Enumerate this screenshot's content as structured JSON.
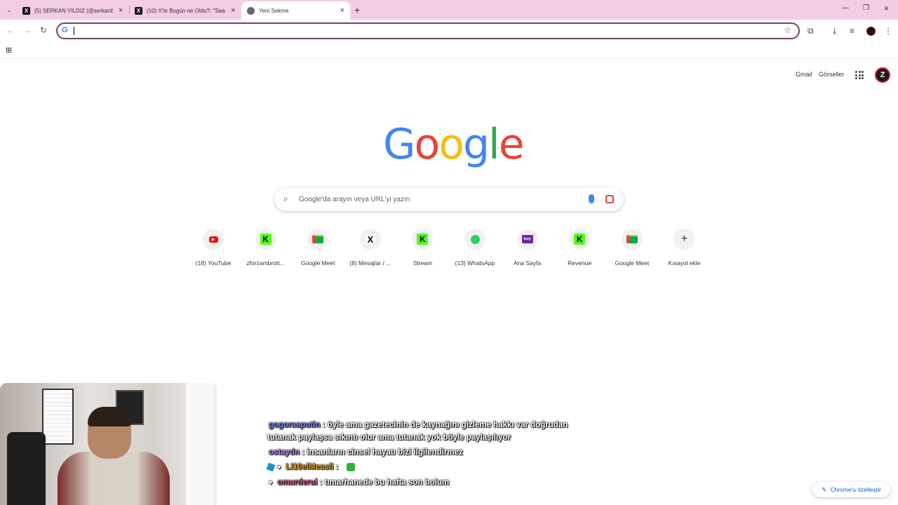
{
  "tabs": [
    {
      "title": "(5) SERKAN YILDIZ (@serkan80y",
      "favicon": "x-icon",
      "active": false
    },
    {
      "title": "(10) X'te Bugün ne Oldu?: \"Saad",
      "favicon": "x-icon",
      "active": false
    },
    {
      "title": "Yeni Sekme",
      "favicon": "chrome-icon",
      "active": true
    }
  ],
  "toolbar": {
    "omnibox_value": ""
  },
  "ntp": {
    "gmail": "Gmail",
    "images": "Görseller",
    "avatar_letter": "Z",
    "logo_letters": [
      {
        "ch": "G",
        "color": "#4285f4"
      },
      {
        "ch": "o",
        "color": "#ea4335"
      },
      {
        "ch": "o",
        "color": "#fbbc05"
      },
      {
        "ch": "g",
        "color": "#4285f4"
      },
      {
        "ch": "l",
        "color": "#34a853"
      },
      {
        "ch": "e",
        "color": "#ea4335"
      }
    ],
    "search_placeholder": "Google'da arayın veya URL'yi yazın",
    "shortcuts": [
      {
        "label": "(18) YouTube",
        "icon": "youtube-icon"
      },
      {
        "label": "zforzambrott...",
        "icon": "kick-icon"
      },
      {
        "label": "Google Meet",
        "icon": "meet-icon"
      },
      {
        "label": "(8) Mesajlar / ...",
        "icon": "x-icon"
      },
      {
        "label": "Stream",
        "icon": "kick-icon"
      },
      {
        "label": "(13) WhatsApp",
        "icon": "whatsapp-icon"
      },
      {
        "label": "Ana Sayfa",
        "icon": "site-icon"
      },
      {
        "label": "Revenue",
        "icon": "kick-icon"
      },
      {
        "label": "Google Meet",
        "icon": "meet-icon"
      },
      {
        "label": "Kısayol ekle",
        "icon": "plus-icon"
      }
    ],
    "customize_label": "Chrome'u özelleştir"
  },
  "chat": [
    {
      "user": "gogorasputin",
      "user_color": "#7b86e8",
      "text": ": öyle ama gazetecinin de kaynağını gizleme hakkı var doğrudan"
    },
    {
      "user": "",
      "user_color": "#ffffff",
      "text": "tutanak paylaşsa sıkıntı olur ama tutanak yok böyle paylaşılıyor"
    },
    {
      "user": "ostaydn",
      "user_color": "#b58be0",
      "text": ": insanların cinsel hayatı bizi ilgilendirmez"
    },
    {
      "user": "LI10elMessii",
      "user_color": "#e0a020",
      "text": ":"
    },
    {
      "user": "omurderui",
      "user_color": "#d05a78",
      "text": ": tımarhanede bu hafta son bolum"
    }
  ]
}
